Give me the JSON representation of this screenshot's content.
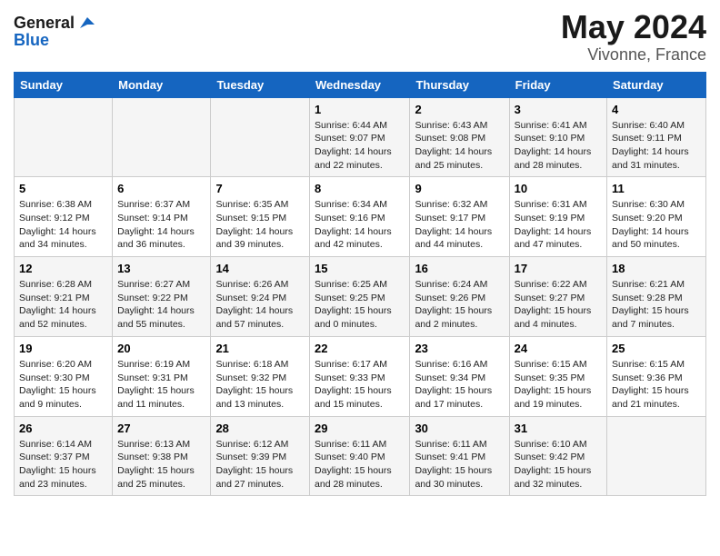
{
  "header": {
    "logo_line1": "General",
    "logo_line2": "Blue",
    "month_year": "May 2024",
    "location": "Vivonne, France"
  },
  "days_of_week": [
    "Sunday",
    "Monday",
    "Tuesday",
    "Wednesday",
    "Thursday",
    "Friday",
    "Saturday"
  ],
  "weeks": [
    [
      {
        "day": "",
        "info": ""
      },
      {
        "day": "",
        "info": ""
      },
      {
        "day": "",
        "info": ""
      },
      {
        "day": "1",
        "info": "Sunrise: 6:44 AM\nSunset: 9:07 PM\nDaylight: 14 hours\nand 22 minutes."
      },
      {
        "day": "2",
        "info": "Sunrise: 6:43 AM\nSunset: 9:08 PM\nDaylight: 14 hours\nand 25 minutes."
      },
      {
        "day": "3",
        "info": "Sunrise: 6:41 AM\nSunset: 9:10 PM\nDaylight: 14 hours\nand 28 minutes."
      },
      {
        "day": "4",
        "info": "Sunrise: 6:40 AM\nSunset: 9:11 PM\nDaylight: 14 hours\nand 31 minutes."
      }
    ],
    [
      {
        "day": "5",
        "info": "Sunrise: 6:38 AM\nSunset: 9:12 PM\nDaylight: 14 hours\nand 34 minutes."
      },
      {
        "day": "6",
        "info": "Sunrise: 6:37 AM\nSunset: 9:14 PM\nDaylight: 14 hours\nand 36 minutes."
      },
      {
        "day": "7",
        "info": "Sunrise: 6:35 AM\nSunset: 9:15 PM\nDaylight: 14 hours\nand 39 minutes."
      },
      {
        "day": "8",
        "info": "Sunrise: 6:34 AM\nSunset: 9:16 PM\nDaylight: 14 hours\nand 42 minutes."
      },
      {
        "day": "9",
        "info": "Sunrise: 6:32 AM\nSunset: 9:17 PM\nDaylight: 14 hours\nand 44 minutes."
      },
      {
        "day": "10",
        "info": "Sunrise: 6:31 AM\nSunset: 9:19 PM\nDaylight: 14 hours\nand 47 minutes."
      },
      {
        "day": "11",
        "info": "Sunrise: 6:30 AM\nSunset: 9:20 PM\nDaylight: 14 hours\nand 50 minutes."
      }
    ],
    [
      {
        "day": "12",
        "info": "Sunrise: 6:28 AM\nSunset: 9:21 PM\nDaylight: 14 hours\nand 52 minutes."
      },
      {
        "day": "13",
        "info": "Sunrise: 6:27 AM\nSunset: 9:22 PM\nDaylight: 14 hours\nand 55 minutes."
      },
      {
        "day": "14",
        "info": "Sunrise: 6:26 AM\nSunset: 9:24 PM\nDaylight: 14 hours\nand 57 minutes."
      },
      {
        "day": "15",
        "info": "Sunrise: 6:25 AM\nSunset: 9:25 PM\nDaylight: 15 hours\nand 0 minutes."
      },
      {
        "day": "16",
        "info": "Sunrise: 6:24 AM\nSunset: 9:26 PM\nDaylight: 15 hours\nand 2 minutes."
      },
      {
        "day": "17",
        "info": "Sunrise: 6:22 AM\nSunset: 9:27 PM\nDaylight: 15 hours\nand 4 minutes."
      },
      {
        "day": "18",
        "info": "Sunrise: 6:21 AM\nSunset: 9:28 PM\nDaylight: 15 hours\nand 7 minutes."
      }
    ],
    [
      {
        "day": "19",
        "info": "Sunrise: 6:20 AM\nSunset: 9:30 PM\nDaylight: 15 hours\nand 9 minutes."
      },
      {
        "day": "20",
        "info": "Sunrise: 6:19 AM\nSunset: 9:31 PM\nDaylight: 15 hours\nand 11 minutes."
      },
      {
        "day": "21",
        "info": "Sunrise: 6:18 AM\nSunset: 9:32 PM\nDaylight: 15 hours\nand 13 minutes."
      },
      {
        "day": "22",
        "info": "Sunrise: 6:17 AM\nSunset: 9:33 PM\nDaylight: 15 hours\nand 15 minutes."
      },
      {
        "day": "23",
        "info": "Sunrise: 6:16 AM\nSunset: 9:34 PM\nDaylight: 15 hours\nand 17 minutes."
      },
      {
        "day": "24",
        "info": "Sunrise: 6:15 AM\nSunset: 9:35 PM\nDaylight: 15 hours\nand 19 minutes."
      },
      {
        "day": "25",
        "info": "Sunrise: 6:15 AM\nSunset: 9:36 PM\nDaylight: 15 hours\nand 21 minutes."
      }
    ],
    [
      {
        "day": "26",
        "info": "Sunrise: 6:14 AM\nSunset: 9:37 PM\nDaylight: 15 hours\nand 23 minutes."
      },
      {
        "day": "27",
        "info": "Sunrise: 6:13 AM\nSunset: 9:38 PM\nDaylight: 15 hours\nand 25 minutes."
      },
      {
        "day": "28",
        "info": "Sunrise: 6:12 AM\nSunset: 9:39 PM\nDaylight: 15 hours\nand 27 minutes."
      },
      {
        "day": "29",
        "info": "Sunrise: 6:11 AM\nSunset: 9:40 PM\nDaylight: 15 hours\nand 28 minutes."
      },
      {
        "day": "30",
        "info": "Sunrise: 6:11 AM\nSunset: 9:41 PM\nDaylight: 15 hours\nand 30 minutes."
      },
      {
        "day": "31",
        "info": "Sunrise: 6:10 AM\nSunset: 9:42 PM\nDaylight: 15 hours\nand 32 minutes."
      },
      {
        "day": "",
        "info": ""
      }
    ]
  ]
}
